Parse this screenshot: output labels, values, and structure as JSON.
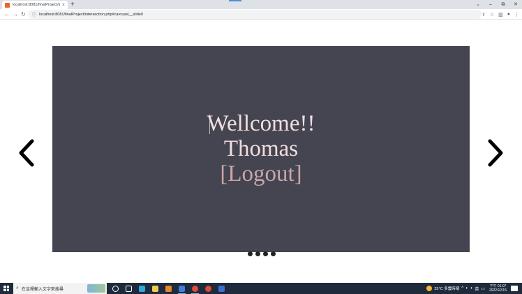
{
  "browser": {
    "tab_title": "localhost:8081/finalProject/int",
    "tab_close": "×",
    "new_tab": "+",
    "url": "localhost:8081/finalProject/intersection.php#carousel__slide0",
    "nav": {
      "back": "←",
      "forward": "→",
      "reload": "↻",
      "site_info": "ⓘ"
    },
    "window_controls": {
      "chevron": "⌄",
      "minimize": "–",
      "maximize": "⧉",
      "close": "✕"
    },
    "toolbar_icons": {
      "share": "⇪",
      "bookmark": "☆",
      "sidepanel": "▥",
      "profile": "●",
      "menu": "⋮"
    }
  },
  "carousel": {
    "welcome_text": "Wellcome!!",
    "username": "Thomas",
    "logout_label": "[Logout]",
    "slide_count": 4,
    "active_slide": 0
  },
  "taskbar": {
    "search_placeholder": "在這裡輸入文字來搜尋",
    "search_glyph": "⌕",
    "weather": "25°C 多雲時晴",
    "tray_chevron": "^",
    "ime": "英",
    "time": "下午 01:07",
    "date": "2022/12/15",
    "apps": [
      {
        "name": "cortana",
        "color": "#ffffff"
      },
      {
        "name": "task-view",
        "color": "#ffffff"
      },
      {
        "name": "edge",
        "color": "#2fa8d8"
      },
      {
        "name": "file-explorer",
        "color": "#f2c94c"
      },
      {
        "name": "orange-app",
        "color": "#e8862a"
      },
      {
        "name": "chrome-dev",
        "color": "#3f7fd8"
      },
      {
        "name": "chrome",
        "color": "#e04b3c"
      },
      {
        "name": "red-app",
        "color": "#d94a3a"
      },
      {
        "name": "pinned-app",
        "color": "#3d6fd1"
      }
    ]
  }
}
